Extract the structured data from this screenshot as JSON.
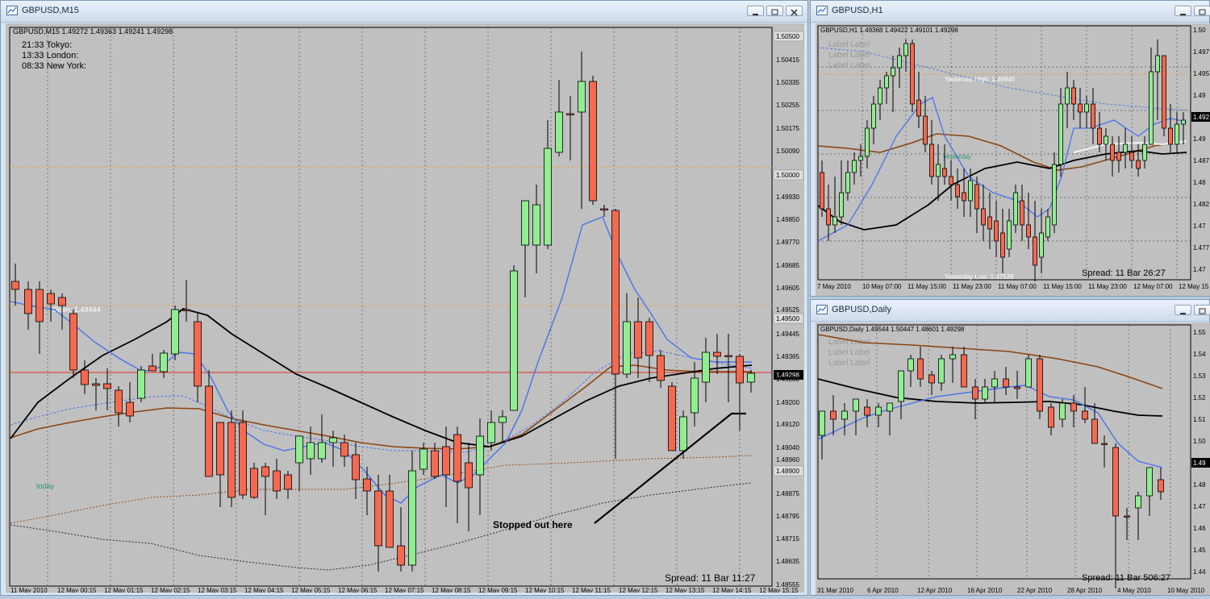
{
  "windows": {
    "m15": {
      "title": "GBPUSD,M15",
      "ohlc": "GBPUSD,M15  1.49272 1.49363 1.49241 1.49298",
      "sessions": [
        "21:33 Tokyo:",
        "13:33 London:",
        "08:33 New York:"
      ],
      "price_axis": [
        "1.50500",
        "1.50415",
        "1.50335",
        "1.50255",
        "1.50175",
        "1.50090",
        "1.50000",
        "1.49930",
        "1.49850",
        "1.49770",
        "1.49685",
        "1.49605",
        "1.49525",
        "1.49500",
        "1.49445",
        "1.49365",
        "1.49298",
        "1.49280",
        "1.49200",
        "1.49120",
        "1.49040",
        "1.48960",
        "1.48900",
        "1.48875",
        "1.48795",
        "1.48715",
        "1.48635",
        "1.48555"
      ],
      "current_price": "1.49298",
      "time_axis": [
        "11 May 2010",
        "12 May 00:15",
        "12 May 01:15",
        "12 May 02:15",
        "12 May 03:15",
        "12 May 04:15",
        "12 May 05:15",
        "12 May 06:15",
        "12 May 07:15",
        "12 May 08:15",
        "12 May 09:15",
        "12 May 10:15",
        "12 May 11:15",
        "12 May 12:15",
        "12 May 13:15",
        "12 May 14:15",
        "12 May 15:15"
      ],
      "status": "Spread: 11   Bar  11:27",
      "annotation": "Stopped out here",
      "open_label": "Open: 1.49444",
      "today_label": "today"
    },
    "h1": {
      "title": "GBPUSD,H1",
      "ohlc": "GBPUSD,H1  1.49368 1.49422 1.49101 1.49298",
      "labels": [
        "Label Label",
        "Label Label",
        "Label Label"
      ],
      "price_axis": [
        "1.50",
        "1.497",
        "1.495",
        "1.49",
        "1.492",
        "1.49",
        "1.487",
        "1.48",
        "1.482",
        "1.47",
        "1.477",
        "1.47"
      ],
      "current_price": "1.492",
      "time_axis": [
        "7 May 2010",
        "10 May 07:00",
        "11 May 15:00",
        "11 May 23:00",
        "11 May 07:00",
        "11 May 15:00",
        "11 May 23:00",
        "12 May 07:00",
        "12 May 15"
      ],
      "status": "Spread: 11   Bar  26:27",
      "high_label": "Yesterday High: 1.49845",
      "low_label": "Yesterday Low: 1.47539",
      "yest_label": "yesterday"
    },
    "daily": {
      "title": "GBPUSD,Daily",
      "ohlc": "GBPUSD,Daily  1.49544 1.50447 1.48601 1.49298",
      "labels": [
        "Label Label",
        "Label Label",
        "Label Label"
      ],
      "price_axis": [
        "1.55",
        "1.54",
        "1.53",
        "1.52",
        "1.51",
        "1.50",
        "1.49",
        "1.48",
        "1.47",
        "1.46",
        "1.45",
        "1.44"
      ],
      "current_price": "1.49",
      "time_axis": [
        "31 Mar 2010",
        "6 Apr 2010",
        "12 Apr 2010",
        "16 Apr 2010",
        "22 Apr 2010",
        "28 Apr 2010",
        "4 May 2010",
        "10 May 2010"
      ],
      "status": "Spread: 11   Bar  506:27"
    }
  },
  "colors": {
    "bull": "#90ee90",
    "bear": "#f4694f",
    "bg": "#c0c0c0",
    "ma_blue": "#4a73e8",
    "ma_black": "#000000",
    "ma_brown": "#8b4513"
  }
}
